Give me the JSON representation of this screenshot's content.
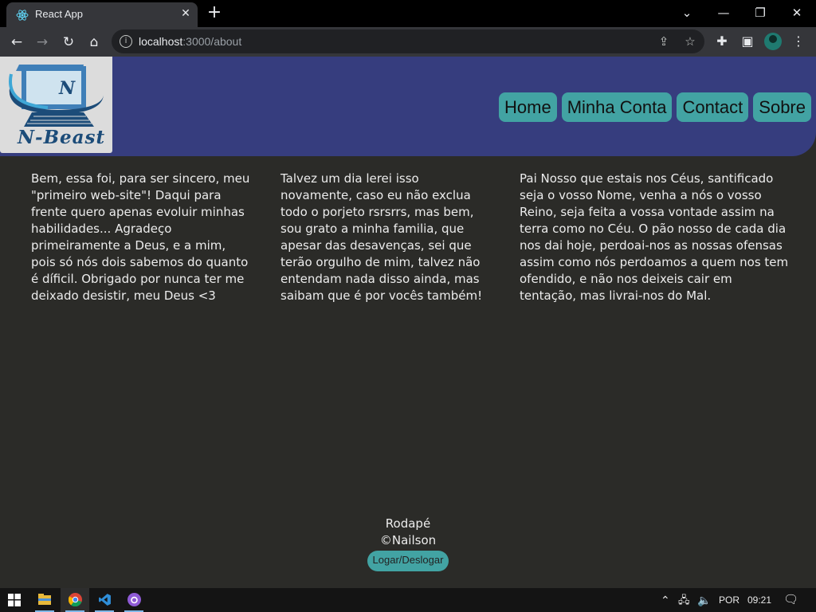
{
  "browser": {
    "tab_title": "React App",
    "url_host": "localhost",
    "url_rest": ":3000/about"
  },
  "site": {
    "logo_text": "N-Beast",
    "logo_letter": "N",
    "nav": [
      "Home",
      "Minha Conta",
      "Contact",
      "Sobre"
    ],
    "columns": [
      "Bem, essa foi, para ser sincero, meu \"primeiro web-site\"! Daqui para frente quero apenas evoluir minhas habilidades... Agradeço primeiramente a Deus, e a mim, pois só nós dois sabemos do quanto é díficil. Obrigado por nunca ter me deixado desistir, meu Deus <3",
      "Talvez um dia lerei isso novamente, caso eu não exclua todo o porjeto rsrsrrs, mas bem, sou grato a minha familia, que apesar das desavenças, sei que terão orgulho de mim, talvez não entendam nada disso ainda, mas saibam que é por vocês também!",
      "Pai Nosso que estais nos Céus, santificado seja o vosso Nome, venha a nós o vosso Reino, seja feita a vossa vontade assim na terra como no Céu. O pão nosso de cada dia nos dai hoje, perdoai-nos as nossas ofensas assim como nós perdoamos a quem nos tem ofendido, e não nos deixeis cair em tentação, mas livrai-nos do Mal."
    ],
    "footer": {
      "title": "Rodapé",
      "copyright": "©Nailson",
      "login_button": "Logar/Deslogar"
    }
  },
  "taskbar": {
    "language": "POR",
    "time": "09:21"
  },
  "colors": {
    "header": "#363d7e",
    "accent": "#42a3a3",
    "page_bg": "#2b2b28"
  }
}
